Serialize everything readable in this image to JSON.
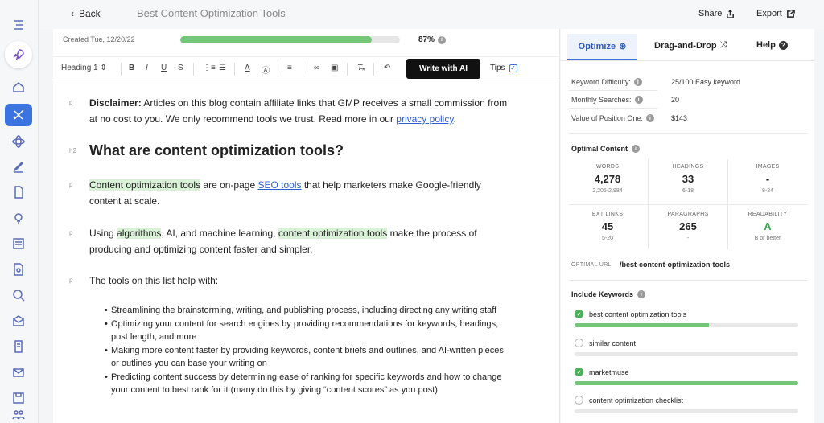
{
  "topbar": {
    "back_label": "Back",
    "doc_title": "Best Content Optimization Tools",
    "share_label": "Share",
    "export_label": "Export"
  },
  "editor": {
    "created_label": "Created",
    "created_date": "Tue, 12/20/22",
    "progress": 0.87,
    "progress_label": "87%",
    "toolbar": {
      "heading_select": "Heading 1 ⇕",
      "bold": "B",
      "italic": "I",
      "underline": "U",
      "strike": "S",
      "write_ai": "Write with AI",
      "tips_label": "Tips"
    },
    "blocks": [
      {
        "tag": "p",
        "type": "disclaimer",
        "bold": "Disclaimer:",
        "text": " Articles on this blog contain affiliate links that GMP receives a small commission from at no cost to you. We only recommend tools we trust. Read more in our ",
        "link": "privacy policy",
        "end": "."
      },
      {
        "tag": "h2",
        "text": "What are content optimization tools?"
      },
      {
        "tag": "p",
        "hl": "Content optimization tools",
        "text1": " are on-page ",
        "link": "SEO tools",
        "text2": " that help marketers make Google-friendly content at scale."
      },
      {
        "tag": "p",
        "text1": "Using ",
        "hl1": "algorithms",
        "text2": ", AI, and machine learning, ",
        "hl2": "content optimization tools",
        "text3": " make the process of producing and optimizing content faster and simpler."
      },
      {
        "tag": "p",
        "text": "The tools on this list help with:"
      }
    ],
    "bullets": [
      "Streamlining the brainstorming, writing, and publishing process, including directing any writing staff",
      "Optimizing your content for search engines by providing recommendations for keywords, headings, post length, and more",
      "Making more content faster by providing keywords, content briefs and outlines, and AI-written pieces or outlines you can base your writing on",
      "Predicting content success by determining ease of ranking for specific keywords and how to change your content to best rank for it (many do this by giving “content scores” as you post)"
    ]
  },
  "panel": {
    "tabs": {
      "optimize": "Optimize",
      "dnd": "Drag-and-Drop",
      "help": "Help"
    },
    "kd_label": "Keyword Difficulty:",
    "kd_value": "25/100 Easy keyword",
    "ms_label": "Monthly Searches:",
    "ms_value": "20",
    "vp_label": "Value of Position One:",
    "vp_value": "$143",
    "optimal_title": "Optimal Content",
    "metrics": [
      {
        "label": "WORDS",
        "value": "4,278",
        "range": "2,205-2,984"
      },
      {
        "label": "HEADINGS",
        "value": "33",
        "range": "6-18"
      },
      {
        "label": "IMAGES",
        "value": "-",
        "range": "8-24"
      },
      {
        "label": "EXT LINKS",
        "value": "45",
        "range": "5-20"
      },
      {
        "label": "PARAGRAPHS",
        "value": "265",
        "range": "-"
      },
      {
        "label": "READABILITY",
        "value": "A",
        "range": "B or better"
      }
    ],
    "optimal_url_label": "OPTIMAL URL",
    "optimal_url": "/best-content-optimization-tools",
    "include_title": "Include Keywords",
    "keywords": [
      {
        "text": "best content optimization tools",
        "done": true,
        "fill": 0.6
      },
      {
        "text": "similar content",
        "done": false,
        "fill": 0
      },
      {
        "text": "marketmuse",
        "done": true,
        "fill": 1
      },
      {
        "text": "content optimization checklist",
        "done": false,
        "fill": 0
      }
    ]
  }
}
